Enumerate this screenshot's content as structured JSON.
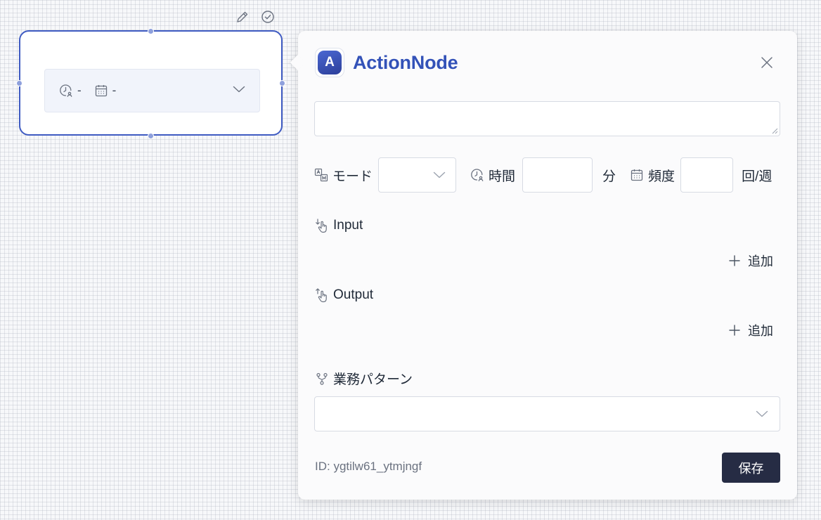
{
  "canvas": {
    "node": {
      "duration_value": "-",
      "frequency_value": "-"
    }
  },
  "panel": {
    "avatar_letter": "A",
    "title": "ActionNode",
    "mode_label": "モード",
    "time_label": "時間",
    "time_unit": "分",
    "frequency_label": "頻度",
    "frequency_unit": "回/週",
    "input_label": "Input",
    "input_add": "追加",
    "output_label": "Output",
    "output_add": "追加",
    "pattern_label": "業務パターン",
    "id_text": "ID: ygtilw61_ytmjngf",
    "save_label": "保存"
  },
  "icons": {
    "edit": "pencil-icon",
    "confirm": "check-circle-icon",
    "close": "close-icon",
    "mode": "translate-icon",
    "time": "clock-user-icon",
    "frequency": "calendar-icon",
    "input": "input-hand-icon",
    "output": "output-hand-icon",
    "pattern": "branch-icon",
    "add": "plus-icon",
    "dropdown": "chevron-down-icon"
  },
  "colors": {
    "accent": "#3352b8",
    "node_border": "#3f5bc2",
    "save_button": "#262c44"
  }
}
